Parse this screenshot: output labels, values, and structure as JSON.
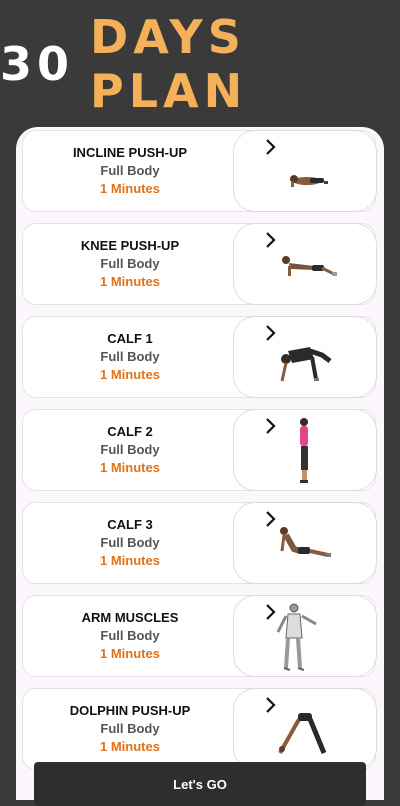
{
  "header": {
    "title_part1": "30",
    "title_part2": "DAYS PLAN",
    "accent_color": "#f4b15a"
  },
  "exercises": [
    {
      "name": "INCLINE PUSH-UP",
      "category": "Full Body",
      "duration": "1 Minutes",
      "icon": "incline-pushup-figure-icon"
    },
    {
      "name": "KNEE PUSH-UP",
      "category": "Full Body",
      "duration": "1 Minutes",
      "icon": "knee-pushup-figure-icon"
    },
    {
      "name": "CALF 1",
      "category": "Full Body",
      "duration": "1 Minutes",
      "icon": "calf-stretch-figure-icon"
    },
    {
      "name": "CALF 2",
      "category": "Full Body",
      "duration": "1 Minutes",
      "icon": "calf-raise-figure-icon"
    },
    {
      "name": "CALF 3",
      "category": "Full Body",
      "duration": "1 Minutes",
      "icon": "cobra-stretch-figure-icon"
    },
    {
      "name": "ARM MUSCLES",
      "category": "Full Body",
      "duration": "1 Minutes",
      "icon": "arm-anatomy-figure-icon"
    },
    {
      "name": "DOLPHIN PUSH-UP",
      "category": "Full Body",
      "duration": "1 Minutes",
      "icon": "dolphin-pushup-figure-icon"
    }
  ],
  "footer": {
    "go_label": "Let's GO"
  },
  "colors": {
    "duration": "#e2731a",
    "background": "#3a3a3a",
    "panel": "#fbf7fd"
  }
}
